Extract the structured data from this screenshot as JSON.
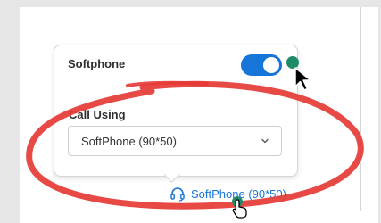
{
  "softphone_panel": {
    "title": "Softphone",
    "toggle_enabled": true,
    "call_using_label": "Call Using",
    "call_using_value": "SoftPhone (90*50)"
  },
  "status_bar": {
    "softphone_link_label": "SoftPhone (90*50)",
    "icon": "headset-icon"
  },
  "colors": {
    "accent": "#1774d8",
    "annotation": "#e53935",
    "click_marker": "#1e8a6a"
  }
}
